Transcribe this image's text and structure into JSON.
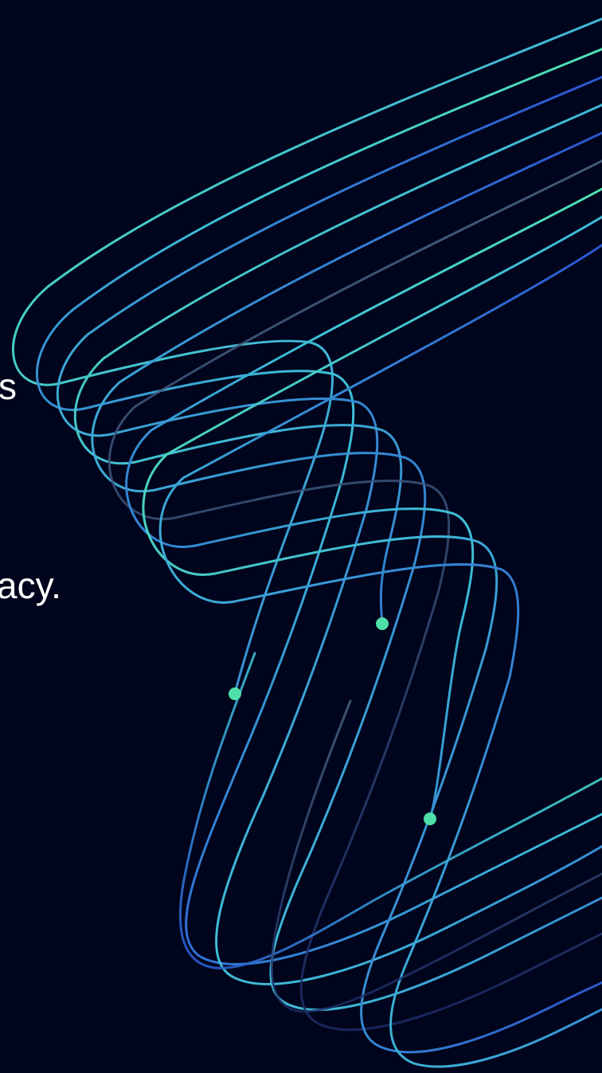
{
  "text_fragments": {
    "line_1_tail": "s",
    "line_2_tail": "acy."
  },
  "colors": {
    "background": "#00041c",
    "line_teal": "#4fe0b0",
    "line_cyan": "#3fc3d6",
    "line_blue": "#2a5fd0",
    "line_slate": "#4e6a86",
    "node_dot": "#4fe0a8"
  }
}
